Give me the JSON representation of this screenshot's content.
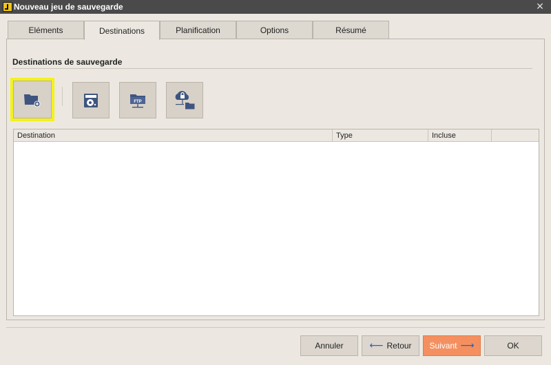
{
  "window": {
    "title": "Nouveau jeu de sauvegarde",
    "close_glyph": "✕"
  },
  "tabs": [
    {
      "label": "Eléments"
    },
    {
      "label": "Destinations",
      "active": true
    },
    {
      "label": "Planification"
    },
    {
      "label": "Options"
    },
    {
      "label": "Résumé"
    }
  ],
  "section": {
    "title": "Destinations de sauvegarde"
  },
  "toolbar": {
    "buttons": [
      {
        "icon": "folder-add-icon"
      },
      {
        "icon": "disc-drive-icon"
      },
      {
        "icon": "ftp-folder-icon"
      },
      {
        "icon": "cloud-lock-folder-icon"
      }
    ]
  },
  "table": {
    "columns": [
      "Destination",
      "Type",
      "Incluse"
    ],
    "rows": []
  },
  "footer": {
    "cancel_label": "Annuler",
    "back_label": "Retour",
    "next_label": "Suivant",
    "ok_label": "OK",
    "back_arrow": "⟵",
    "next_arrow": "⟶"
  },
  "colors": {
    "accent": "#f4905f",
    "highlight": "#f4f21b",
    "icon": "#3f5580"
  }
}
